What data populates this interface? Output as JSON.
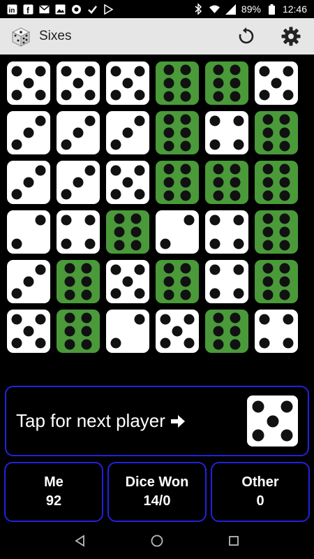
{
  "status_bar": {
    "battery": "89%",
    "time": "12:46",
    "left_icons": [
      "linkedin-icon",
      "facebook-icon",
      "gmail-icon",
      "image-icon",
      "camera-icon",
      "tasks-icon",
      "play-store-icon"
    ],
    "right_icons": [
      "bluetooth-icon",
      "wifi-icon",
      "signal-icon",
      "battery-icon"
    ]
  },
  "app_bar": {
    "title": "Sixes",
    "logo_icon": "dice-logo-icon",
    "actions": [
      "refresh-icon",
      "settings-gear-icon"
    ]
  },
  "colors": {
    "white_die": "#ffffff",
    "green_die": "#4a9a3a",
    "pip": "#111111",
    "panel_border": "#2222dd",
    "app_bar": "#e6e6e6"
  },
  "board": {
    "rows": [
      [
        {
          "value": 5,
          "won": false
        },
        {
          "value": 5,
          "won": false
        },
        {
          "value": 5,
          "won": false
        },
        {
          "value": 6,
          "won": true
        },
        {
          "value": 6,
          "won": true
        },
        {
          "value": 5,
          "won": false
        }
      ],
      [
        {
          "value": 3,
          "won": false
        },
        {
          "value": 3,
          "won": false
        },
        {
          "value": 3,
          "won": false
        },
        {
          "value": 6,
          "won": true
        },
        {
          "value": 4,
          "won": false
        },
        {
          "value": 6,
          "won": true
        }
      ],
      [
        {
          "value": 3,
          "won": false
        },
        {
          "value": 3,
          "won": false
        },
        {
          "value": 5,
          "won": false
        },
        {
          "value": 6,
          "won": true
        },
        {
          "value": 6,
          "won": true
        },
        {
          "value": 6,
          "won": true
        }
      ],
      [
        {
          "value": 2,
          "won": false
        },
        {
          "value": 4,
          "won": false
        },
        {
          "value": 6,
          "won": true
        },
        {
          "value": 2,
          "won": false
        },
        {
          "value": 4,
          "won": false
        },
        {
          "value": 6,
          "won": true
        }
      ],
      [
        {
          "value": 3,
          "won": false
        },
        {
          "value": 6,
          "won": true
        },
        {
          "value": 5,
          "won": false
        },
        {
          "value": 6,
          "won": true
        },
        {
          "value": 4,
          "won": false
        },
        {
          "value": 6,
          "won": true
        }
      ],
      [
        {
          "value": 5,
          "won": false
        },
        {
          "value": 6,
          "won": true
        },
        {
          "value": 2,
          "won": false
        },
        {
          "value": 5,
          "won": false
        },
        {
          "value": 6,
          "won": true
        },
        {
          "value": 4,
          "won": false
        }
      ]
    ]
  },
  "next_panel": {
    "label": "Tap for next player",
    "arrow_icon": "arrow-right-icon",
    "current_die": 5
  },
  "scores": [
    {
      "title": "Me",
      "value": "92"
    },
    {
      "title": "Dice Won",
      "value": "14/0"
    },
    {
      "title": "Other",
      "value": "0"
    }
  ],
  "nav_bar": [
    "back-icon",
    "home-icon",
    "recents-icon"
  ]
}
